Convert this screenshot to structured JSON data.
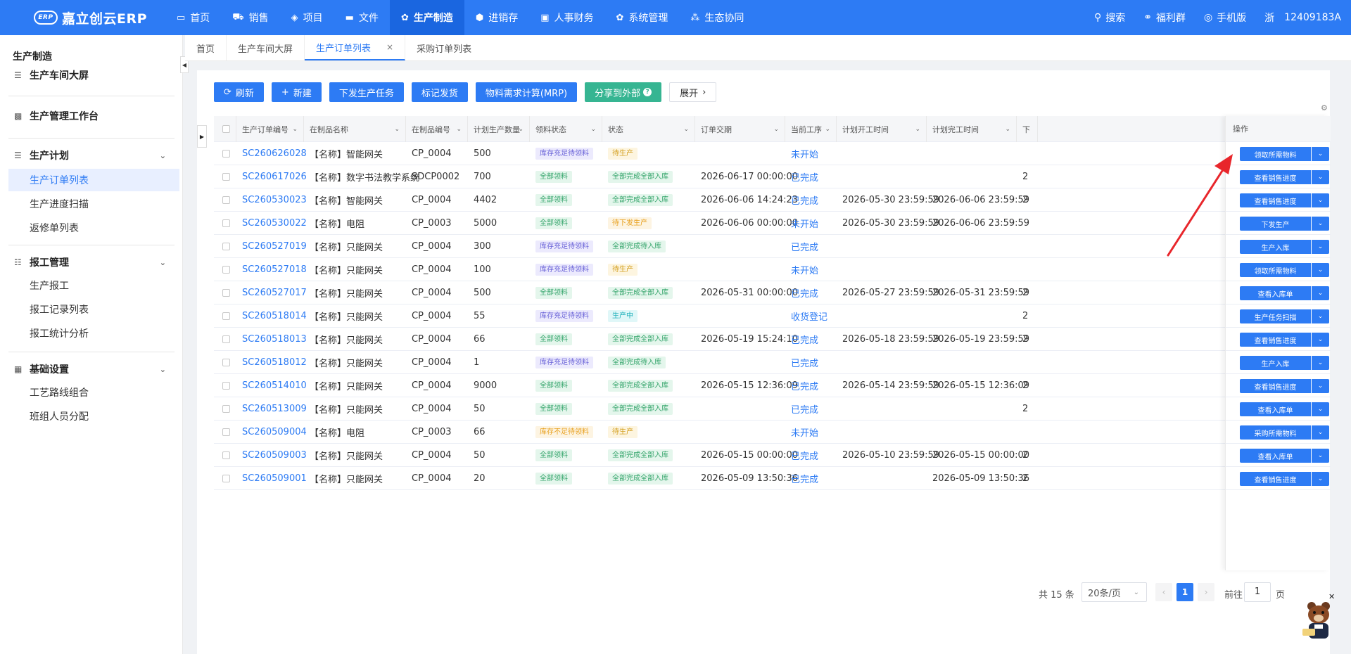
{
  "app": {
    "logo_badge": "ERP",
    "logo_text": "嘉立创云ERP"
  },
  "nav": [
    {
      "label": "首页",
      "icon": "monitor-icon"
    },
    {
      "label": "销售",
      "icon": "cart-icon"
    },
    {
      "label": "项目",
      "icon": "layers-icon"
    },
    {
      "label": "文件",
      "icon": "folder-icon"
    },
    {
      "label": "生产制造",
      "icon": "gear-icon",
      "active": true
    },
    {
      "label": "进销存",
      "icon": "box-icon"
    },
    {
      "label": "人事财务",
      "icon": "id-card-icon"
    },
    {
      "label": "系统管理",
      "icon": "gear-icon"
    },
    {
      "label": "生态协同",
      "icon": "network-icon"
    }
  ],
  "top_right": {
    "search": "搜索",
    "welfare": "福利群",
    "mobile": "手机版",
    "region": "浙",
    "account": "12409183A"
  },
  "sidebar": {
    "title": "生产制造",
    "workshop": "生产车间大屏",
    "workbench": "生产管理工作台",
    "plan": {
      "label": "生产计划",
      "items": [
        "生产订单列表",
        "生产进度扫描",
        "返修单列表"
      ]
    },
    "report": {
      "label": "报工管理",
      "items": [
        "生产报工",
        "报工记录列表",
        "报工统计分析"
      ]
    },
    "basic": {
      "label": "基础设置",
      "items": [
        "工艺路线组合",
        "班组人员分配"
      ]
    }
  },
  "tabs": [
    "首页",
    "生产车间大屏",
    "生产订单列表",
    "采购订单列表"
  ],
  "tab_close": "×",
  "toolbar": {
    "refresh": "刷新",
    "new": "新建",
    "dispatch": "下发生产任务",
    "mark": "标记发货",
    "mrp": "物料需求计算(MRP)",
    "share": "分享到外部",
    "expand": "展开"
  },
  "columns": {
    "order_no": "生产订单编号",
    "product_name": "在制品名称",
    "product_code": "在制品编号",
    "qty": "计划生产数量",
    "material": "领料状态",
    "status": "状态",
    "due": "订单交期",
    "process": "当前工序",
    "start": "计划开工时间",
    "end": "计划完工时间",
    "truncated": "下",
    "op": "操作"
  },
  "rows": [
    {
      "no": "SC260626028",
      "name": "【名称】智能网关",
      "code": "CP_0004",
      "qty": "500",
      "mat": "库存充足待领料",
      "matc": "purple",
      "st": "待生产",
      "stc": "yellow",
      "due": "",
      "proc": "未开始",
      "start": "",
      "end": "",
      "x": "",
      "op": "领取所需物料"
    },
    {
      "no": "SC260617026",
      "name": "【名称】数字书法教学系统",
      "code": "SDCP0002",
      "qty": "700",
      "mat": "全部领料",
      "matc": "green",
      "st": "全部完成全部入库",
      "stc": "green",
      "due": "2026-06-17 00:00:00",
      "proc": "已完成",
      "start": "",
      "end": "",
      "x": "2",
      "op": "查看销售进度"
    },
    {
      "no": "SC260530023",
      "name": "【名称】智能网关",
      "code": "CP_0004",
      "qty": "4402",
      "mat": "全部领料",
      "matc": "green",
      "st": "全部完成全部入库",
      "stc": "green",
      "due": "2026-06-06 14:24:23",
      "proc": "已完成",
      "start": "2026-05-30 23:59:59",
      "end": "2026-06-06 23:59:59",
      "x": "2",
      "op": "查看销售进度"
    },
    {
      "no": "SC260530022",
      "name": "【名称】电阻",
      "code": "CP_0003",
      "qty": "5000",
      "mat": "全部领料",
      "matc": "green",
      "st": "待下发生产",
      "stc": "orange",
      "due": "2026-06-06 00:00:00",
      "proc": "未开始",
      "start": "2026-05-30 23:59:59",
      "end": "2026-06-06 23:59:59",
      "x": "",
      "op": "下发生产"
    },
    {
      "no": "SC260527019",
      "name": "【名称】只能网关",
      "code": "CP_0004",
      "qty": "300",
      "mat": "库存充足待领料",
      "matc": "purple",
      "st": "全部完成待入库",
      "stc": "green",
      "due": "",
      "proc": "已完成",
      "start": "",
      "end": "",
      "x": "",
      "op": "生产入库"
    },
    {
      "no": "SC260527018",
      "name": "【名称】只能网关",
      "code": "CP_0004",
      "qty": "100",
      "mat": "库存充足待领料",
      "matc": "purple",
      "st": "待生产",
      "stc": "yellow",
      "due": "",
      "proc": "未开始",
      "start": "",
      "end": "",
      "x": "",
      "op": "领取所需物料"
    },
    {
      "no": "SC260527017",
      "name": "【名称】只能网关",
      "code": "CP_0004",
      "qty": "500",
      "mat": "全部领料",
      "matc": "green",
      "st": "全部完成全部入库",
      "stc": "green",
      "due": "2026-05-31 00:00:00",
      "proc": "已完成",
      "start": "2026-05-27 23:59:59",
      "end": "2026-05-31 23:59:59",
      "x": "2",
      "op": "查看入库单"
    },
    {
      "no": "SC260518014",
      "name": "【名称】只能网关",
      "code": "CP_0004",
      "qty": "55",
      "mat": "库存充足待领料",
      "matc": "purple",
      "st": "生产中",
      "stc": "cyan",
      "due": "",
      "proc": "收货登记",
      "start": "",
      "end": "",
      "x": "2",
      "op": "生产任务扫描"
    },
    {
      "no": "SC260518013",
      "name": "【名称】只能网关",
      "code": "CP_0004",
      "qty": "66",
      "mat": "全部领料",
      "matc": "green",
      "st": "全部完成全部入库",
      "stc": "green",
      "due": "2026-05-19 15:24:10",
      "proc": "已完成",
      "start": "2026-05-18 23:59:59",
      "end": "2026-05-19 23:59:59",
      "x": "2",
      "op": "查看销售进度"
    },
    {
      "no": "SC260518012",
      "name": "【名称】只能网关",
      "code": "CP_0004",
      "qty": "1",
      "mat": "库存充足待领料",
      "matc": "purple",
      "st": "全部完成待入库",
      "stc": "green",
      "due": "",
      "proc": "已完成",
      "start": "",
      "end": "",
      "x": "",
      "op": "生产入库"
    },
    {
      "no": "SC260514010",
      "name": "【名称】只能网关",
      "code": "CP_0004",
      "qty": "9000",
      "mat": "全部领料",
      "matc": "green",
      "st": "全部完成全部入库",
      "stc": "green",
      "due": "2026-05-15 12:36:09",
      "proc": "已完成",
      "start": "2026-05-14 23:59:59",
      "end": "2026-05-15 12:36:09",
      "x": "2",
      "op": "查看销售进度"
    },
    {
      "no": "SC260513009",
      "name": "【名称】只能网关",
      "code": "CP_0004",
      "qty": "50",
      "mat": "全部领料",
      "matc": "green",
      "st": "全部完成全部入库",
      "stc": "green",
      "due": "",
      "proc": "已完成",
      "start": "",
      "end": "",
      "x": "2",
      "op": "查看入库单"
    },
    {
      "no": "SC260509004",
      "name": "【名称】电阻",
      "code": "CP_0003",
      "qty": "66",
      "mat": "库存不足待领料",
      "matc": "orange",
      "st": "待生产",
      "stc": "yellow",
      "due": "",
      "proc": "未开始",
      "start": "",
      "end": "",
      "x": "",
      "op": "采购所需物料"
    },
    {
      "no": "SC260509003",
      "name": "【名称】只能网关",
      "code": "CP_0004",
      "qty": "50",
      "mat": "全部领料",
      "matc": "green",
      "st": "全部完成全部入库",
      "stc": "green",
      "due": "2026-05-15 00:00:00",
      "proc": "已完成",
      "start": "2026-05-10 23:59:59",
      "end": "2026-05-15 00:00:00",
      "x": "2",
      "op": "查看入库单"
    },
    {
      "no": "SC260509001",
      "name": "【名称】只能网关",
      "code": "CP_0004",
      "qty": "20",
      "mat": "全部领料",
      "matc": "green",
      "st": "全部完成全部入库",
      "stc": "green",
      "due": "2026-05-09 13:50:36",
      "proc": "已完成",
      "start": "",
      "end": "2026-05-09 13:50:36",
      "x": "2",
      "op": "查看销售进度"
    }
  ],
  "pagination": {
    "total": "共 15 条",
    "page_size": "20条/页",
    "current": "1",
    "goto_label": "前往",
    "goto_value": "1",
    "page_unit": "页"
  },
  "colors": {
    "primary": "#2d7bf4",
    "share": "#36b592",
    "annotation_arrow": "#e8262b"
  }
}
